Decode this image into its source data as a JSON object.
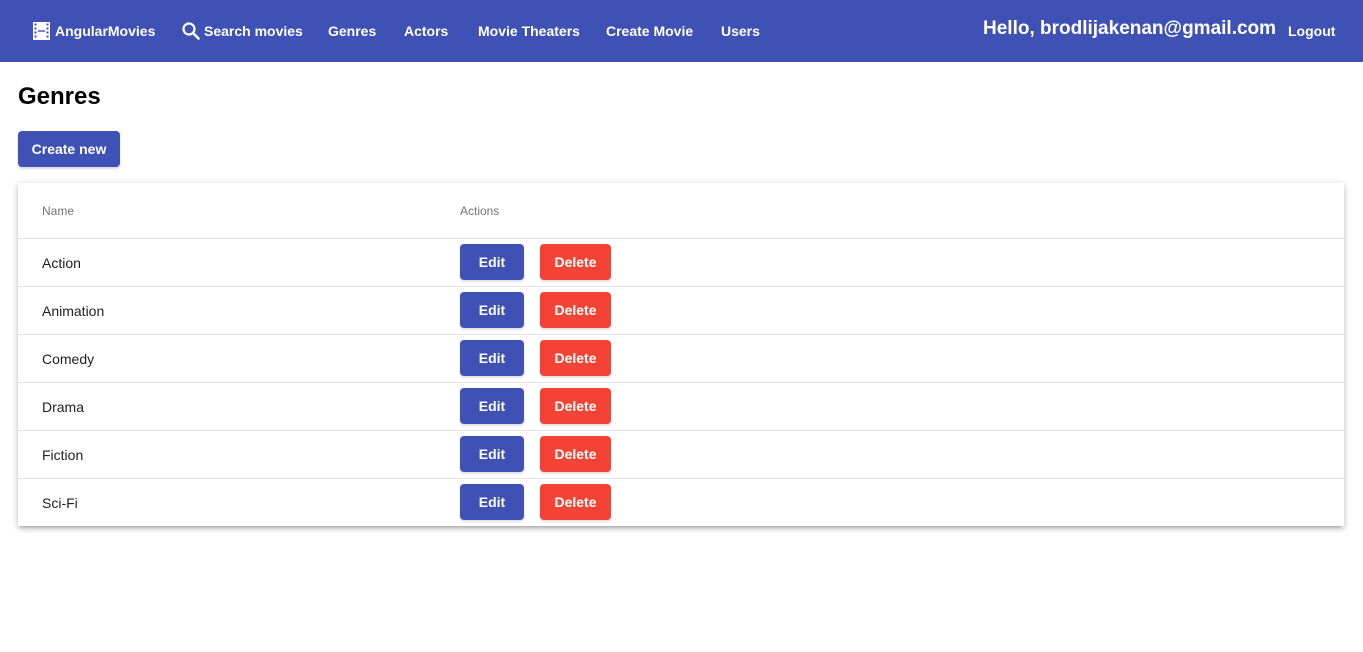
{
  "toolbar": {
    "brand": "AngularMovies",
    "brand_icon": "film-icon",
    "nav": [
      "Search movies",
      "Genres",
      "Actors",
      "Movie Theaters",
      "Create Movie",
      "Users"
    ],
    "search_icon": "search-icon",
    "greeting": "Hello, brodlijakenan@gmail.com",
    "logout": "Logout",
    "color": "#3f51b5"
  },
  "page": {
    "title": "Genres",
    "create_label": "Create new"
  },
  "table": {
    "columns": [
      "Name",
      "Actions"
    ],
    "rows": [
      {
        "name": "Action"
      },
      {
        "name": "Animation"
      },
      {
        "name": "Comedy"
      },
      {
        "name": "Drama"
      },
      {
        "name": "Fiction"
      },
      {
        "name": "Sci-Fi"
      }
    ],
    "edit_label": "Edit",
    "delete_label": "Delete",
    "edit_color": "#3f51b5",
    "delete_color": "#f44336"
  }
}
